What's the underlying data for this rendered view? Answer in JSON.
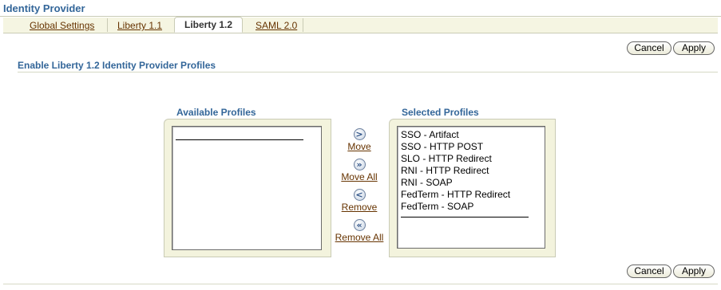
{
  "page": {
    "title": "Identity Provider"
  },
  "tabs": [
    {
      "label": "Global Settings",
      "active": false
    },
    {
      "label": "Liberty 1.1",
      "active": false
    },
    {
      "label": "Liberty 1.2",
      "active": true
    },
    {
      "label": "SAML 2.0",
      "active": false
    }
  ],
  "buttons": {
    "cancel": "Cancel",
    "apply": "Apply"
  },
  "section": {
    "header": "Enable Liberty 1.2 Identity Provider Profiles"
  },
  "shuttle": {
    "available_label": "Available Profiles",
    "selected_label": "Selected Profiles",
    "available_items": [],
    "selected_items": [
      "SSO - Artifact",
      "SSO - HTTP POST",
      "SLO - HTTP Redirect",
      "RNI - HTTP Redirect",
      "RNI - SOAP",
      "FedTerm - HTTP Redirect",
      "FedTerm - SOAP"
    ],
    "controls": {
      "move": {
        "label": "Move",
        "icon": "move-right-icon",
        "glyph": ">"
      },
      "move_all": {
        "label": "Move All",
        "icon": "move-all-right-icon",
        "glyph": "»"
      },
      "remove": {
        "label": "Remove",
        "icon": "move-left-icon",
        "glyph": "<"
      },
      "remove_all": {
        "label": "Remove All",
        "icon": "move-all-left-icon",
        "glyph": "«"
      }
    }
  },
  "colors": {
    "header_blue": "#336699",
    "link_brown": "#663300",
    "tab_bar": "#f5f5e2",
    "frame_bg": "#f3f3dd"
  }
}
